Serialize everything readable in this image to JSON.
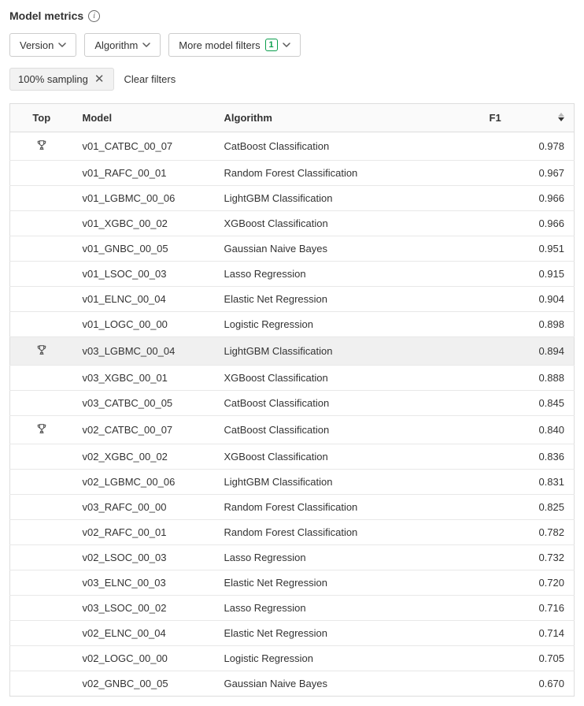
{
  "header": {
    "title": "Model metrics"
  },
  "filters": {
    "version_label": "Version",
    "algorithm_label": "Algorithm",
    "more_label": "More model filters",
    "more_count": "1"
  },
  "chips": {
    "sampling_label": "100% sampling",
    "clear_label": "Clear filters"
  },
  "columns": {
    "top": "Top",
    "model": "Model",
    "algorithm": "Algorithm",
    "f1": "F1"
  },
  "rows": [
    {
      "top": true,
      "model": "v01_CATBC_00_07",
      "algorithm": "CatBoost Classification",
      "f1": "0.978",
      "highlight": false
    },
    {
      "top": false,
      "model": "v01_RAFC_00_01",
      "algorithm": "Random Forest Classification",
      "f1": "0.967",
      "highlight": false
    },
    {
      "top": false,
      "model": "v01_LGBMC_00_06",
      "algorithm": "LightGBM Classification",
      "f1": "0.966",
      "highlight": false
    },
    {
      "top": false,
      "model": "v01_XGBC_00_02",
      "algorithm": "XGBoost Classification",
      "f1": "0.966",
      "highlight": false
    },
    {
      "top": false,
      "model": "v01_GNBC_00_05",
      "algorithm": "Gaussian Naive Bayes",
      "f1": "0.951",
      "highlight": false
    },
    {
      "top": false,
      "model": "v01_LSOC_00_03",
      "algorithm": "Lasso Regression",
      "f1": "0.915",
      "highlight": false
    },
    {
      "top": false,
      "model": "v01_ELNC_00_04",
      "algorithm": "Elastic Net Regression",
      "f1": "0.904",
      "highlight": false
    },
    {
      "top": false,
      "model": "v01_LOGC_00_00",
      "algorithm": "Logistic Regression",
      "f1": "0.898",
      "highlight": false
    },
    {
      "top": true,
      "model": "v03_LGBMC_00_04",
      "algorithm": "LightGBM Classification",
      "f1": "0.894",
      "highlight": true
    },
    {
      "top": false,
      "model": "v03_XGBC_00_01",
      "algorithm": "XGBoost Classification",
      "f1": "0.888",
      "highlight": false
    },
    {
      "top": false,
      "model": "v03_CATBC_00_05",
      "algorithm": "CatBoost Classification",
      "f1": "0.845",
      "highlight": false
    },
    {
      "top": true,
      "model": "v02_CATBC_00_07",
      "algorithm": "CatBoost Classification",
      "f1": "0.840",
      "highlight": false
    },
    {
      "top": false,
      "model": "v02_XGBC_00_02",
      "algorithm": "XGBoost Classification",
      "f1": "0.836",
      "highlight": false
    },
    {
      "top": false,
      "model": "v02_LGBMC_00_06",
      "algorithm": "LightGBM Classification",
      "f1": "0.831",
      "highlight": false
    },
    {
      "top": false,
      "model": "v03_RAFC_00_00",
      "algorithm": "Random Forest Classification",
      "f1": "0.825",
      "highlight": false
    },
    {
      "top": false,
      "model": "v02_RAFC_00_01",
      "algorithm": "Random Forest Classification",
      "f1": "0.782",
      "highlight": false
    },
    {
      "top": false,
      "model": "v02_LSOC_00_03",
      "algorithm": "Lasso Regression",
      "f1": "0.732",
      "highlight": false
    },
    {
      "top": false,
      "model": "v03_ELNC_00_03",
      "algorithm": "Elastic Net Regression",
      "f1": "0.720",
      "highlight": false
    },
    {
      "top": false,
      "model": "v03_LSOC_00_02",
      "algorithm": "Lasso Regression",
      "f1": "0.716",
      "highlight": false
    },
    {
      "top": false,
      "model": "v02_ELNC_00_04",
      "algorithm": "Elastic Net Regression",
      "f1": "0.714",
      "highlight": false
    },
    {
      "top": false,
      "model": "v02_LOGC_00_00",
      "algorithm": "Logistic Regression",
      "f1": "0.705",
      "highlight": false
    },
    {
      "top": false,
      "model": "v02_GNBC_00_05",
      "algorithm": "Gaussian Naive Bayes",
      "f1": "0.670",
      "highlight": false
    }
  ]
}
